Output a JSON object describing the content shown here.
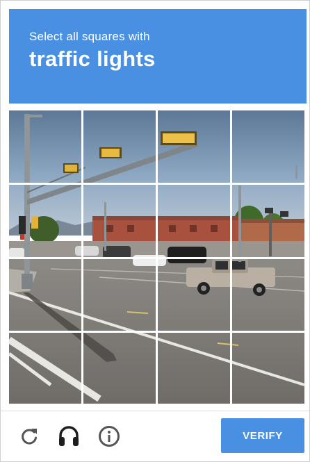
{
  "header": {
    "instruction": "Select all squares with",
    "keyword": "traffic lights"
  },
  "grid": {
    "rows": 4,
    "cols": 4
  },
  "footer": {
    "reload_icon": "reload-icon",
    "audio_icon": "headphones-icon",
    "info_icon": "info-icon",
    "verify_label": "VERIFY"
  },
  "colors": {
    "accent": "#4a90e2",
    "text_on_accent": "#ffffff",
    "icon": "#555555"
  }
}
